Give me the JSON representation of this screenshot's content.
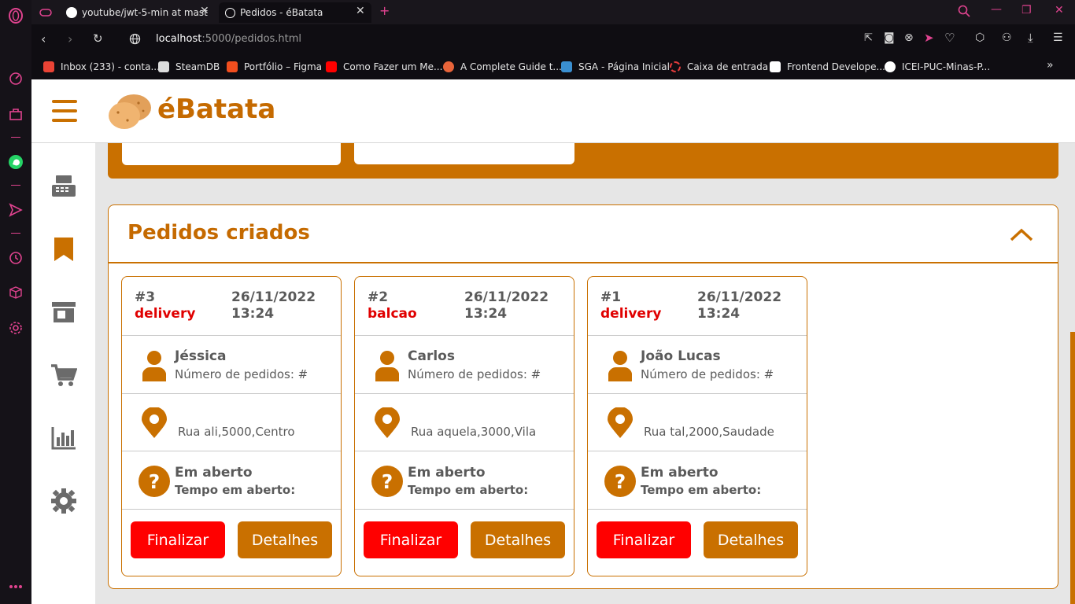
{
  "browser": {
    "tabs": [
      {
        "title": "youtube/jwt-5-min at mast"
      },
      {
        "title": "Pedidos - éBatata"
      }
    ],
    "address": {
      "host": "localhost",
      "path": ":5000/pedidos.html"
    },
    "bookmarks": [
      {
        "label": "Inbox (233) - conta..."
      },
      {
        "label": "SteamDB"
      },
      {
        "label": "Portfólio – Figma"
      },
      {
        "label": "Como Fazer um Me..."
      },
      {
        "label": "A Complete Guide t..."
      },
      {
        "label": "SGA - Página Inicial"
      },
      {
        "label": "Caixa de entrada"
      },
      {
        "label": "Frontend Develope..."
      },
      {
        "label": "ICEI-PUC-Minas-P..."
      }
    ]
  },
  "app": {
    "brand": "éBatata",
    "section_title": "Pedidos criados",
    "orders": [
      {
        "number": "#3",
        "type": "delivery",
        "date": "26/11/2022",
        "time": "13:24",
        "customer": "Jéssica",
        "orders_count": "Número de pedidos: #",
        "address": "Rua ali,5000,Centro",
        "status": "Em aberto",
        "status_time": "Tempo em aberto:",
        "finish_label": "Finalizar",
        "details_label": "Detalhes"
      },
      {
        "number": "#2",
        "type": "balcao",
        "date": "26/11/2022",
        "time": "13:24",
        "customer": "Carlos",
        "orders_count": "Número de pedidos: #",
        "address": "Rua aquela,3000,Vila",
        "status": "Em aberto",
        "status_time": "Tempo em aberto:",
        "finish_label": "Finalizar",
        "details_label": "Detalhes"
      },
      {
        "number": "#1",
        "type": "delivery",
        "date": "26/11/2022",
        "time": "13:24",
        "customer": "João Lucas",
        "orders_count": "Número de pedidos: #",
        "address": "Rua tal,2000,Saudade",
        "status": "Em aberto",
        "status_time": "Tempo em aberto:",
        "finish_label": "Finalizar",
        "details_label": "Detalhes"
      }
    ]
  },
  "colors": {
    "brand": "#c97000",
    "danger": "#ff0000",
    "accent": "#e0438f"
  }
}
